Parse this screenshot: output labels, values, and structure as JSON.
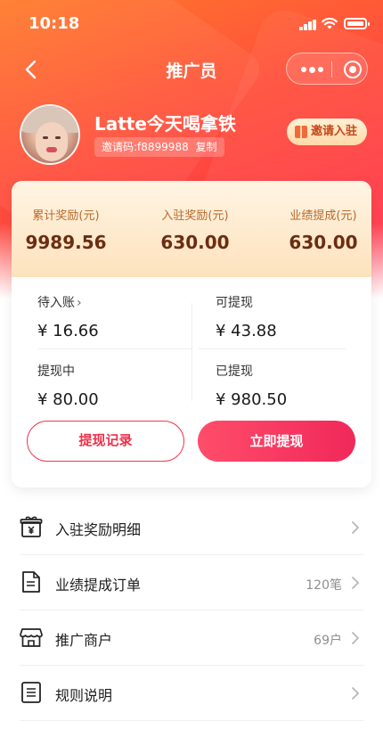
{
  "status_bar": {
    "time": "10:18"
  },
  "nav": {
    "title": "推广员"
  },
  "profile": {
    "name": "Latte今天喝拿铁",
    "invite_code": "邀请码:f8899988",
    "copy_label": "复制",
    "invite_button": "邀请入驻"
  },
  "summary": {
    "items": [
      {
        "label": "累计奖励(元)",
        "value": "9989.56"
      },
      {
        "label": "入驻奖励(元)",
        "value": "630.00"
      },
      {
        "label": "业绩提成(元)",
        "value": "630.00"
      }
    ]
  },
  "balances": {
    "pending": {
      "label": "待入账",
      "chevron": "›",
      "value": "¥ 16.66"
    },
    "withdrawable": {
      "label": "可提现",
      "value": "¥ 43.88"
    },
    "withdrawing": {
      "label": "提现中",
      "value": "¥ 80.00"
    },
    "withdrawn": {
      "label": "已提现",
      "value": "¥ 980.50"
    }
  },
  "actions": {
    "records": "提现记录",
    "withdraw": "立即提现"
  },
  "menu": [
    {
      "label": "入驻奖励明细",
      "right": "",
      "icon": "gift-box-yen-icon"
    },
    {
      "label": "业绩提成订单",
      "right": "120笔",
      "icon": "document-icon"
    },
    {
      "label": "推广商户",
      "right": "69户",
      "icon": "store-icon"
    },
    {
      "label": "规则说明",
      "right": "",
      "icon": "rules-list-icon"
    }
  ],
  "colors": {
    "brand_red": "#f0285a",
    "hero_orange": "#ff7a2a",
    "stat_value": "#6b2d12",
    "stat_label": "#b86a2c"
  }
}
